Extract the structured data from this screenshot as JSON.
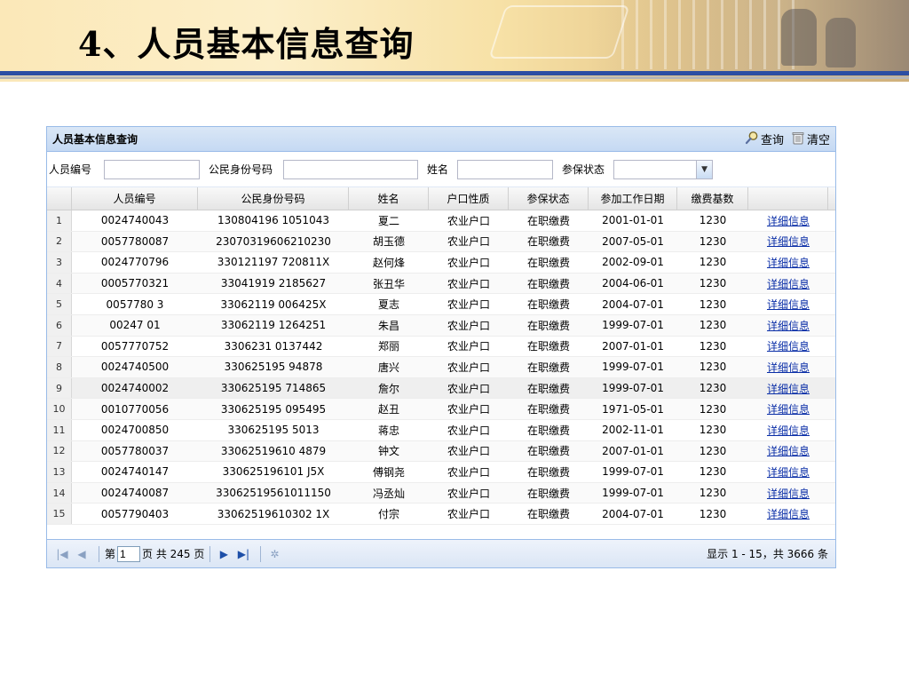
{
  "slide": {
    "title": "4、人员基本信息查询"
  },
  "panel": {
    "title": "人员基本信息查询",
    "query_label": "查询",
    "clear_label": "清空"
  },
  "form": {
    "person_id_label": "人员编号",
    "person_id_value": "",
    "citizen_id_label": "公民身份号码",
    "citizen_id_value": "",
    "name_label": "姓名",
    "name_value": "",
    "status_label": "参保状态",
    "status_value": ""
  },
  "grid": {
    "columns": [
      "",
      "人员编号",
      "公民身份号码",
      "姓名",
      "户口性质",
      "参保状态",
      "参加工作日期",
      "缴费基数",
      ""
    ],
    "rows": [
      [
        "1",
        "0024740043",
        "130804196  1051043",
        "夏二",
        "农业户口",
        "在职缴费",
        "2001-01-01",
        "1230",
        "详细信息"
      ],
      [
        "2",
        "0057780087",
        "23070319606210230",
        "胡玉德",
        "农业户口",
        "在职缴费",
        "2007-05-01",
        "1230",
        "详细信息"
      ],
      [
        "3",
        "0024770796",
        "330121197  720811X",
        "赵何烽",
        "农业户口",
        "在职缴费",
        "2002-09-01",
        "1230",
        "详细信息"
      ],
      [
        "4",
        "0005770321",
        "33041919   2185627",
        "张丑华",
        "农业户口",
        "在职缴费",
        "2004-06-01",
        "1230",
        "详细信息"
      ],
      [
        "5",
        "0057780  3",
        "33062119   006425X",
        "夏志",
        "农业户口",
        "在职缴费",
        "2004-07-01",
        "1230",
        "详细信息"
      ],
      [
        "6",
        "00247   01",
        "33062119   1264251",
        "朱昌",
        "农业户口",
        "在职缴费",
        "1999-07-01",
        "1230",
        "详细信息"
      ],
      [
        "7",
        "0057770752",
        "3306231   0137442",
        "郑丽",
        "农业户口",
        "在职缴费",
        "2007-01-01",
        "1230",
        "详细信息"
      ],
      [
        "8",
        "0024740500",
        "330625195   94878",
        "唐兴",
        "农业户口",
        "在职缴费",
        "1999-07-01",
        "1230",
        "详细信息"
      ],
      [
        "9",
        "0024740002",
        "330625195  714865",
        "詹尔",
        "农业户口",
        "在职缴费",
        "1999-07-01",
        "1230",
        "详细信息"
      ],
      [
        "10",
        "0010770056",
        "330625195  095495",
        "赵丑",
        "农业户口",
        "在职缴费",
        "1971-05-01",
        "1230",
        "详细信息"
      ],
      [
        "11",
        "0024700850",
        "330625195   5013",
        "蒋忠",
        "农业户口",
        "在职缴费",
        "2002-11-01",
        "1230",
        "详细信息"
      ],
      [
        "12",
        "0057780037",
        "33062519610  4879",
        "钟文",
        "农业户口",
        "在职缴费",
        "2007-01-01",
        "1230",
        "详细信息"
      ],
      [
        "13",
        "0024740147",
        "330625196101  J5X",
        "傅钢尧",
        "农业户口",
        "在职缴费",
        "1999-07-01",
        "1230",
        "详细信息"
      ],
      [
        "14",
        "0024740087",
        "33062519561011150",
        "冯丞灿",
        "农业户口",
        "在职缴费",
        "1999-07-01",
        "1230",
        "详细信息"
      ],
      [
        "15",
        "0057790403",
        "33062519610302  1X",
        "付宗",
        "农业户口",
        "在职缴费",
        "2004-07-01",
        "1230",
        "详细信息"
      ]
    ],
    "selected_row": 9
  },
  "pager": {
    "page_prefix": "第",
    "page_value": "1",
    "page_suffix": "页 共 245 页",
    "summary": "显示 1 - 15，共 3666 条"
  },
  "icons": {
    "query": "magnifier-icon",
    "clear": "trash-icon"
  },
  "colors": {
    "panel_border": "#99bbe8",
    "link": "#0a2ea7",
    "banner_rule": "#2c4ea3"
  }
}
